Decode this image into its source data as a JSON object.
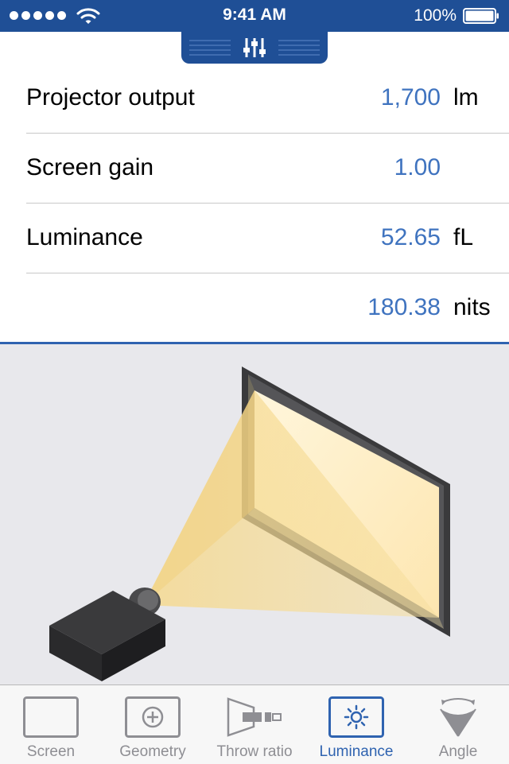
{
  "status_bar": {
    "time": "9:41 AM",
    "battery_percent": "100%"
  },
  "rows": [
    {
      "label": "Projector output",
      "value": "1,700",
      "unit": "lm"
    },
    {
      "label": "Screen gain",
      "value": "1.00",
      "unit": ""
    },
    {
      "label": "Luminance",
      "value": "52.65",
      "unit": "fL"
    },
    {
      "label": "",
      "value": "180.38",
      "unit": "nits"
    }
  ],
  "tabs": [
    {
      "label": "Screen",
      "icon": "screen-icon",
      "active": false
    },
    {
      "label": "Geometry",
      "icon": "geometry-icon",
      "active": false
    },
    {
      "label": "Throw ratio",
      "icon": "throw-ratio-icon",
      "active": false
    },
    {
      "label": "Luminance",
      "icon": "luminance-icon",
      "active": true
    },
    {
      "label": "Angle",
      "icon": "angle-icon",
      "active": false
    }
  ],
  "colors": {
    "accent": "#1f4f96",
    "value_text": "#3f73bf",
    "active_tab": "#2f63b0",
    "inactive_tab": "#8e8e93",
    "illustration_bg": "#e8e8ec"
  }
}
